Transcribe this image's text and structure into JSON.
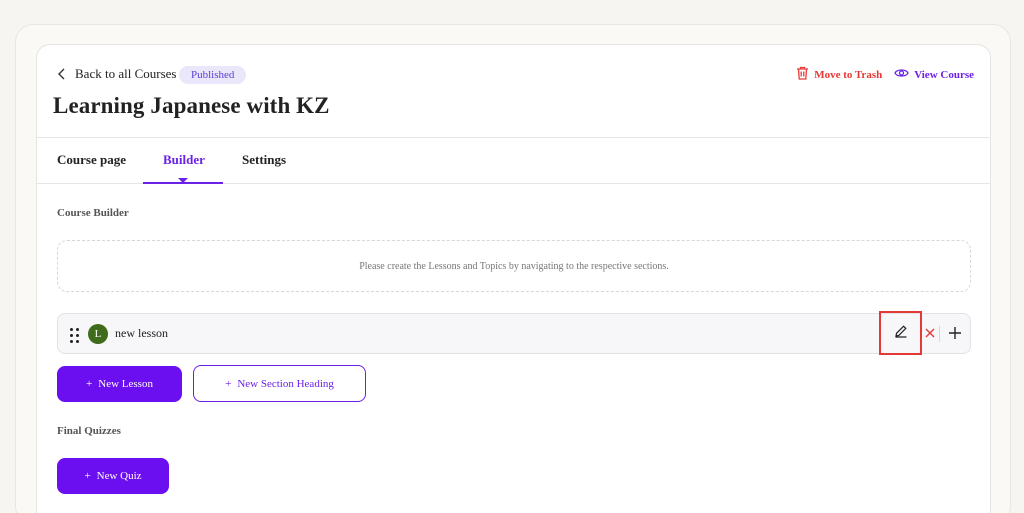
{
  "header": {
    "back_label": "Back to all Courses",
    "status_badge": "Published",
    "course_title": "Learning Japanese with KZ",
    "trash_label": "Move to Trash",
    "view_label": "View Course"
  },
  "tabs": [
    {
      "label": "Course page",
      "active": false
    },
    {
      "label": "Builder",
      "active": true
    },
    {
      "label": "Settings",
      "active": false
    }
  ],
  "builder": {
    "heading": "Course Builder",
    "empty_message": "Please create the Lessons and Topics by navigating to the respective sections.",
    "lesson": {
      "avatar_letter": "L",
      "name": "new lesson"
    },
    "new_lesson_label": "New Lesson",
    "new_section_label": "New Section Heading"
  },
  "quizzes": {
    "heading": "Final Quizzes",
    "new_quiz_label": "New Quiz"
  },
  "colors": {
    "accent": "#6b0ff0",
    "danger": "#e53935",
    "badge_bg": "#ebe7fb",
    "avatar": "#3f6b1a"
  },
  "icons": {
    "back": "chevron-left-icon",
    "trash": "trash-icon",
    "view": "eye-icon",
    "drag": "drag-handle-icon",
    "edit": "pencil-icon",
    "delete": "close-icon",
    "add": "plus-icon"
  }
}
